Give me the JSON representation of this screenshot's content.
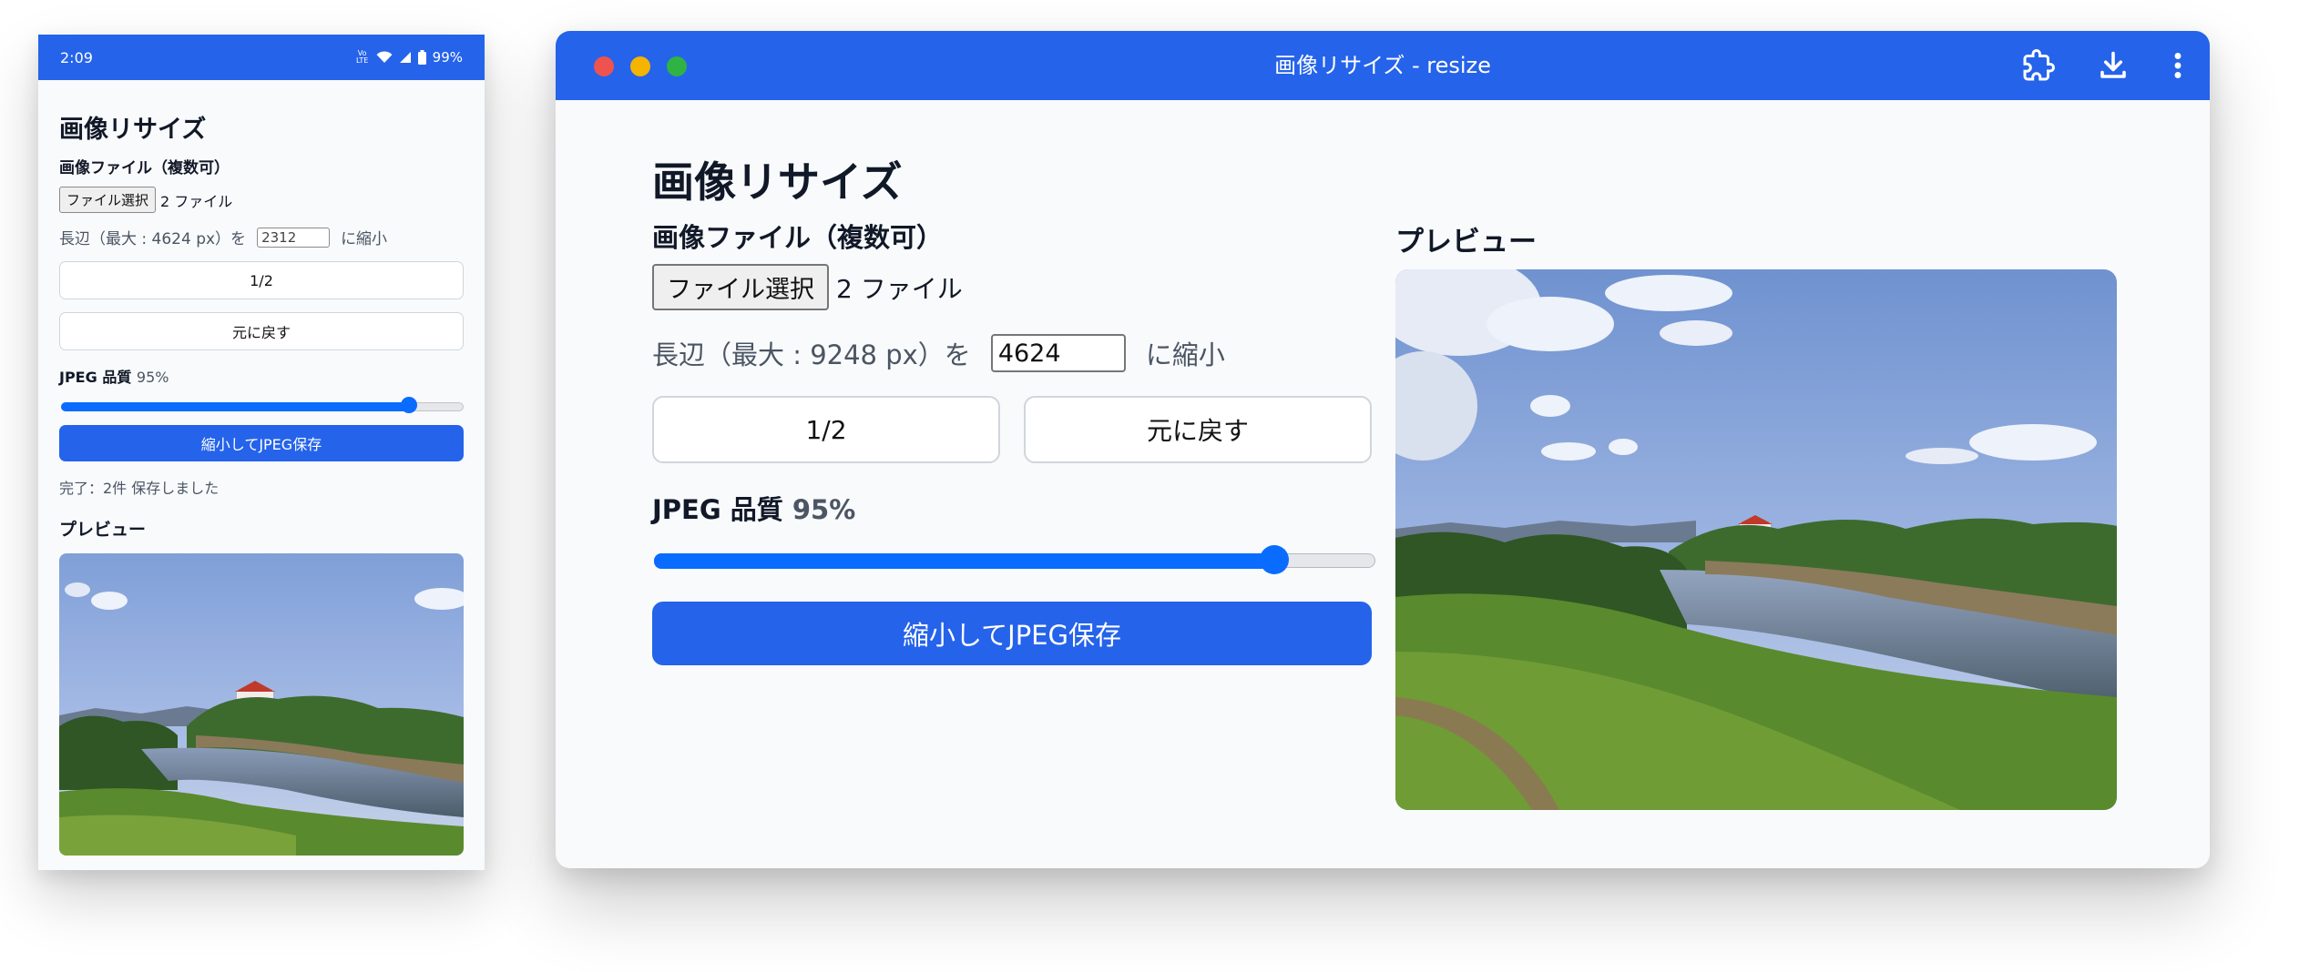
{
  "colors": {
    "accent": "#2563eb",
    "slider": "#0a6cff",
    "bg": "#f8fafc"
  },
  "mobile": {
    "status": {
      "time": "2:09",
      "network": "Vo LTE",
      "battery": "99%"
    },
    "title": "画像リサイズ",
    "file_label": "画像ファイル（複数可）",
    "file_button": "ファイル選択",
    "file_count": "2 ファイル",
    "long_edge_label": "長辺（最大 : 4624 px）を",
    "long_edge_value": "2312",
    "long_edge_suffix": "に縮小",
    "half_button": "1/2",
    "reset_button": "元に戻す",
    "quality_label": "JPEG 品質",
    "quality_value": "95%",
    "quality_fraction": 0.88,
    "save_button": "縮小してJPEG保存",
    "status_text": "完了：2件 保存しました",
    "preview_title": "プレビュー"
  },
  "desktop": {
    "window_title": "画像リサイズ - resize",
    "titlebar_icons": [
      "extension-icon",
      "download-icon",
      "more-vert-icon"
    ],
    "title": "画像リサイズ",
    "file_label": "画像ファイル（複数可）",
    "file_button": "ファイル選択",
    "file_count": "2 ファイル",
    "long_edge_label": "長辺（最大 : 9248 px）を",
    "long_edge_value": "4624",
    "long_edge_suffix": "に縮小",
    "half_button": "1/2",
    "reset_button": "元に戻す",
    "quality_label": "JPEG 品質",
    "quality_value": "95%",
    "quality_fraction": 0.88,
    "save_button": "縮小してJPEG保存",
    "preview_title": "プレビュー"
  }
}
